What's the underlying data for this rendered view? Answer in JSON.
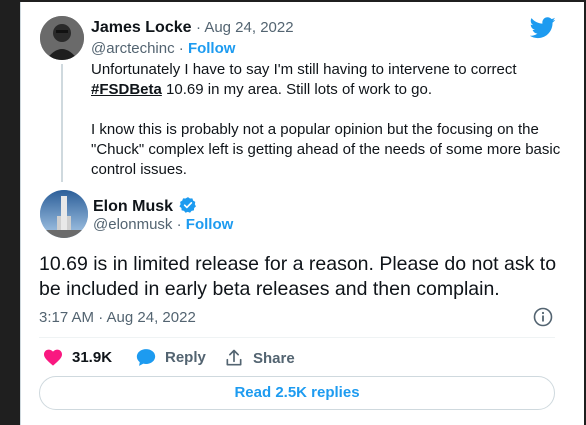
{
  "quoted_tweet": {
    "name": "James Locke",
    "date": "Aug 24, 2022",
    "handle": "@arctechinc",
    "separator": "·",
    "follow_label": "Follow",
    "text_p1_pre": "Unfortunately I have to say I'm still having to intervene to correct",
    "hashtag": "#FSDBeta",
    "text_p1_post": " 10.69 in my area. Still lots of work to go.",
    "text_p2": "I know this is probably not a popular opinion but the focusing on the \"Chuck\" complex left is getting ahead of the needs of some more basic control issues."
  },
  "main_tweet": {
    "name": "Elon Musk",
    "handle": "@elonmusk",
    "separator": "·",
    "follow_label": "Follow",
    "text": "10.69 is in limited release for a reason. Please do not ask to be included in early beta releases and then complain.",
    "timestamp": "3:17 AM · Aug 24, 2022"
  },
  "actions": {
    "like_count": "31.9K",
    "reply_label": "Reply",
    "share_label": "Share"
  },
  "read_replies_label": "Read 2.5K replies",
  "colors": {
    "accent": "#1d9bf0",
    "like": "#f91880",
    "muted": "#536471"
  }
}
